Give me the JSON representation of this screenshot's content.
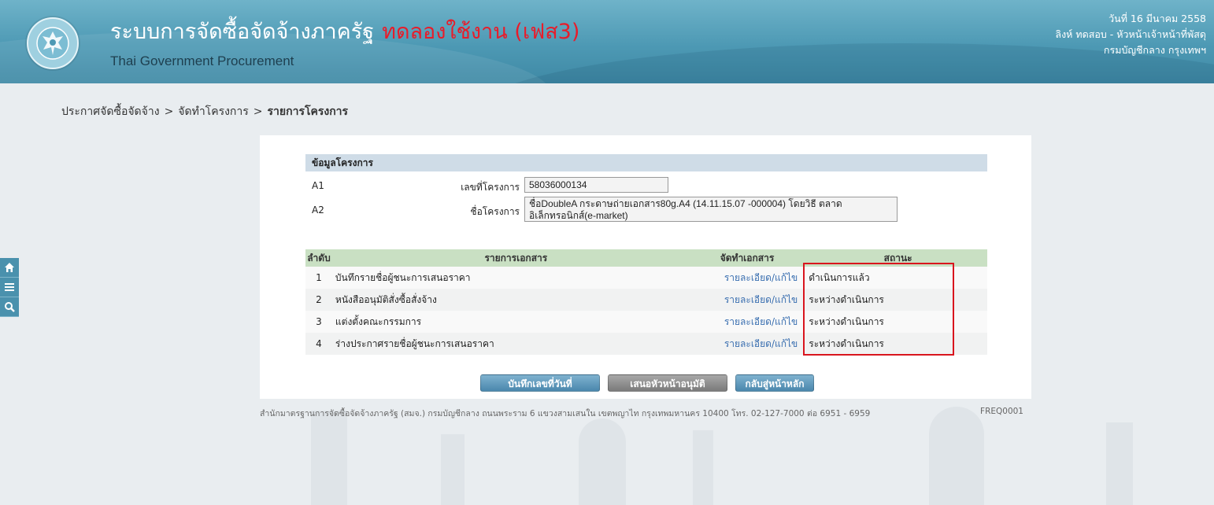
{
  "header": {
    "title": "ระบบการจัดซื้อจัดจ้างภาครัฐ",
    "test_label": "ทดลองใช้งาน (เฟส3)",
    "subtitle": "Thai Government Procurement",
    "date": "วันที่ 16 มีนาคม 2558",
    "user": "ลิงห์ ทดสอบ - หัวหน้าเจ้าหน้าที่พัสดุ",
    "department": "กรมบัญชีกลาง กรุงเทพฯ"
  },
  "breadcrumb": {
    "items": [
      "ประกาศจัดซื้อจัดจ้าง",
      "จัดทำโครงการ"
    ],
    "separator": ">",
    "current": "รายการโครงการ"
  },
  "project": {
    "section_title": "ข้อมูลโครงการ",
    "number_code": "A1",
    "number_label": "เลขที่โครงการ",
    "number_value": "58036000134",
    "name_code": "A2",
    "name_label": "ชื่อโครงการ",
    "name_value": "ชื่อDoubleA กระดาษถ่ายเอกสาร80g.A4 (14.11.15.07 -000004) โดยวิธี ตลาดอิเล็กทรอนิกส์(e-market)"
  },
  "documents": {
    "columns": [
      "ลำดับ",
      "รายการเอกสาร",
      "จัดทำเอกสาร",
      "สถานะ"
    ],
    "rows": [
      {
        "no": "1",
        "name": "บันทึกรายชื่อผู้ชนะการเสนอราคา",
        "action": "รายละเอียด/แก้ไข",
        "status": "ดำเนินการแล้ว"
      },
      {
        "no": "2",
        "name": "หนังสืออนุมัติสั่งซื้อสั่งจ้าง",
        "action": "รายละเอียด/แก้ไข",
        "status": "ระหว่างดำเนินการ"
      },
      {
        "no": "3",
        "name": "แต่งตั้งคณะกรรมการ",
        "action": "รายละเอียด/แก้ไข",
        "status": "ระหว่างดำเนินการ"
      },
      {
        "no": "4",
        "name": "ร่างประกาศรายชื่อผู้ชนะการเสนอราคา",
        "action": "รายละเอียด/แก้ไข",
        "status": "ระหว่างดำเนินการ"
      }
    ]
  },
  "buttons": {
    "save_date": "บันทึกเลขที่วันที่",
    "submit_approval": "เสนอหัวหน้าอนุมัติ",
    "back_main": "กลับสู่หน้าหลัก"
  },
  "footer": {
    "text": "สำนักมาตรฐานการจัดซื้อจัดจ้างภาครัฐ (สมจ.) กรมบัญชีกลาง ถนนพระราม 6 แขวงสามเสนใน เขตพญาไท กรุงเทพมหานคร 10400 โทร. 02-127-7000 ต่อ 6951 - 6959",
    "code": "FREQ0001"
  },
  "side_tools": [
    "home-icon",
    "menu-icon",
    "search-icon"
  ],
  "colors": {
    "header": "#4d99b4",
    "highlight": "#d9151e",
    "test_label": "#e81c2a",
    "link": "#3a6fb0"
  }
}
